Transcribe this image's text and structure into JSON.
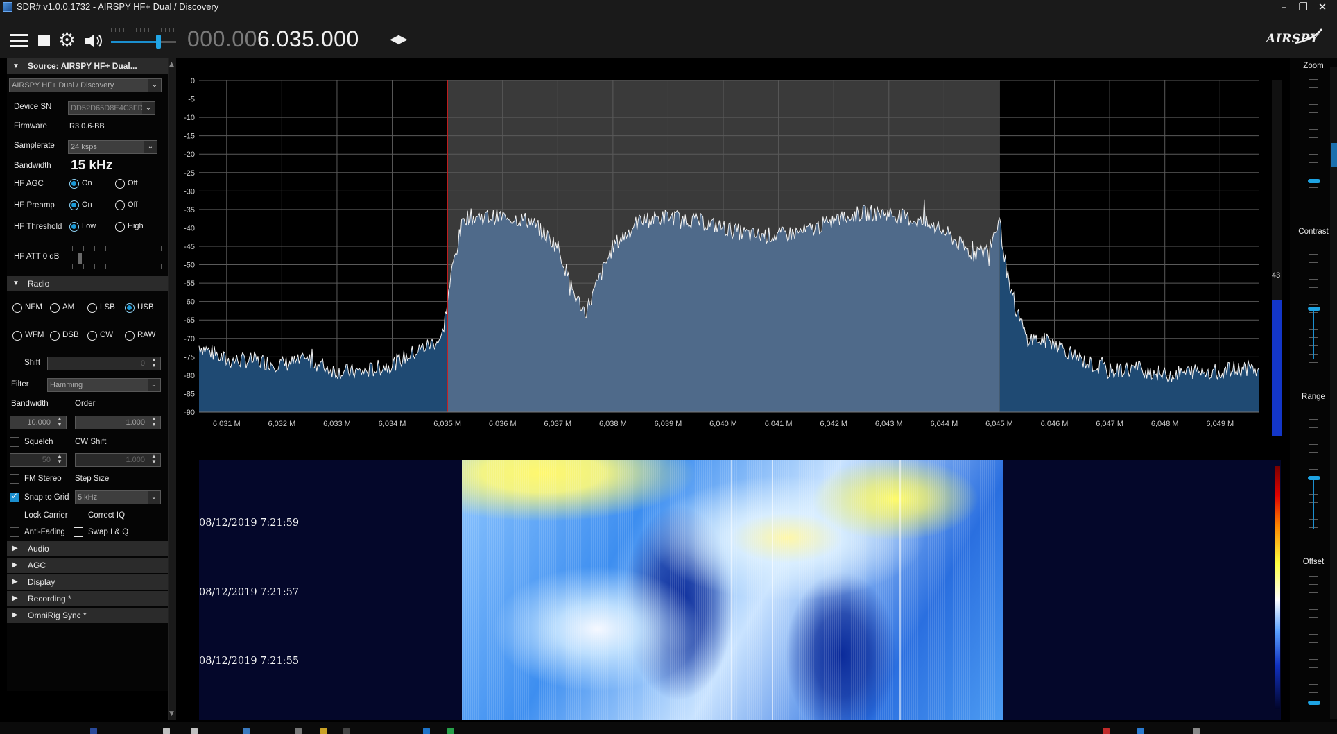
{
  "window": {
    "title": "SDR# v1.0.0.1732 - AIRSPY HF+ Dual / Discovery",
    "minimize": "–",
    "maximize": "❐",
    "close": "✕"
  },
  "toolbar": {
    "frequency_dim": "000.00",
    "frequency_bright": "6.035.000",
    "logo": "AIRSPY",
    "volume_fraction": 0.72
  },
  "source": {
    "header": "Source: AIRSPY HF+ Dual...",
    "device": "AIRSPY HF+ Dual / Discovery",
    "device_sn_label": "Device SN",
    "device_sn": "DD52D65D8E4C3FD",
    "firmware_label": "Firmware",
    "firmware": "R3.0.6-BB",
    "samplerate_label": "Samplerate",
    "samplerate": "24 ksps",
    "bandwidth_label": "Bandwidth",
    "bandwidth": "15 kHz",
    "hf_agc_label": "HF AGC",
    "hf_preamp_label": "HF Preamp",
    "hf_threshold_label": "HF Threshold",
    "on_label": "On",
    "off_label": "Off",
    "low_label": "Low",
    "high_label": "High",
    "hf_att_label": "HF ATT 0 dB"
  },
  "radio": {
    "header": "Radio",
    "modes": [
      "NFM",
      "AM",
      "LSB",
      "USB",
      "WFM",
      "DSB",
      "CW",
      "RAW"
    ],
    "selected_mode": "USB",
    "shift_label": "Shift",
    "shift_value": "0",
    "filter_label": "Filter",
    "filter_value": "Hamming",
    "bandwidth_label": "Bandwidth",
    "order_label": "Order",
    "bandwidth_value": "10.000",
    "order_value": "1.000",
    "squelch_label": "Squelch",
    "cw_shift_label": "CW Shift",
    "squelch_value": "50",
    "cw_shift_value": "1.000",
    "fm_stereo_label": "FM Stereo",
    "step_size_label": "Step Size",
    "snap_to_grid_label": "Snap to Grid",
    "step_size_value": "5 kHz",
    "lock_carrier_label": "Lock Carrier",
    "correct_iq_label": "Correct IQ",
    "anti_fading_label": "Anti-Fading",
    "swap_iq_label": "Swap I & Q"
  },
  "collapsed_sections": [
    "Audio",
    "AGC",
    "Display",
    "Recording *",
    "OmniRig Sync *"
  ],
  "right_panel": {
    "zoom_label": "Zoom",
    "contrast_label": "Contrast",
    "range_label": "Range",
    "offset_label": "Offset",
    "signal_value": "43",
    "signal_fraction": 0.38
  },
  "waterfall": {
    "timestamps": [
      "08/12/2019 7:21:59",
      "08/12/2019 7:21:57",
      "08/12/2019 7:21:55"
    ]
  },
  "colors": {
    "accent": "#1b9ad8",
    "spectrum_fill": "#1f4a73",
    "passband_fill": "#4f6a8a",
    "carrier_line": "#d01818"
  },
  "chart_data": {
    "type": "line",
    "title": "",
    "xlabel": "",
    "ylabel": "",
    "ylim": [
      -90,
      0
    ],
    "xlim": [
      6.0305,
      6.0497
    ],
    "y_ticks": [
      0,
      -5,
      -10,
      -15,
      -20,
      -25,
      -30,
      -35,
      -40,
      -45,
      -50,
      -55,
      -60,
      -65,
      -70,
      -75,
      -80,
      -85,
      -90
    ],
    "x_ticks": [
      "6,031 M",
      "6,032 M",
      "6,033 M",
      "6,034 M",
      "6,035 M",
      "6,036 M",
      "6,037 M",
      "6,038 M",
      "6,039 M",
      "6,040 M",
      "6,041 M",
      "6,042 M",
      "6,043 M",
      "6,044 M",
      "6,045 M",
      "6,046 M",
      "6,047 M",
      "6,048 M",
      "6,049 M"
    ],
    "passband": [
      6.035,
      6.045
    ],
    "carrier": 6.035,
    "series": [
      {
        "x": [
          6.0305,
          6.031,
          6.0315,
          6.032,
          6.0325,
          6.033,
          6.0335,
          6.034,
          6.0345,
          6.0349,
          6.0351,
          6.0353,
          6.036,
          6.0365,
          6.037,
          6.0373,
          6.0375,
          6.038,
          6.0385,
          6.039,
          6.0395,
          6.04,
          6.0405,
          6.041,
          6.0415,
          6.042,
          6.0425,
          6.043,
          6.0435,
          6.044,
          6.0445,
          6.0448,
          6.045,
          6.0452,
          6.0455,
          6.046,
          6.0465,
          6.047,
          6.0475,
          6.048,
          6.0485,
          6.049,
          6.0495,
          6.0497
        ],
        "y": [
          -72,
          -76,
          -76,
          -77,
          -76,
          -79,
          -79,
          -77,
          -73,
          -70,
          -50,
          -37,
          -37,
          -38,
          -45,
          -58,
          -63,
          -45,
          -38,
          -37,
          -38,
          -40,
          -42,
          -42,
          -41,
          -38,
          -36,
          -36,
          -38,
          -41,
          -47,
          -46,
          -38,
          -58,
          -70,
          -71,
          -76,
          -79,
          -78,
          -80,
          -79,
          -79,
          -78,
          -79
        ]
      }
    ]
  }
}
